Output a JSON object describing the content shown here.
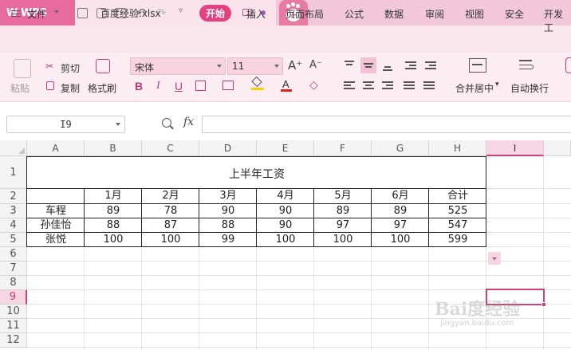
{
  "titlebar": {
    "app_name": "WPS",
    "doc_tab": "百度经验.xlsx"
  },
  "menu": {
    "file": "文件",
    "tabs": [
      "开始",
      "插入",
      "页面布局",
      "公式",
      "数据",
      "审阅",
      "视图",
      "安全",
      "开发工"
    ]
  },
  "ribbon": {
    "paste": "粘贴",
    "cut": "剪切",
    "copy": "复制",
    "format_painter": "格式刷",
    "font_name": "宋体",
    "font_size": "11",
    "merge_center": "合并居中",
    "wrap_text": "自动换行",
    "bold": "B",
    "italic": "I",
    "underline": "U"
  },
  "formula_bar": {
    "name_box": "I9",
    "fx": "fx",
    "formula": ""
  },
  "sheet": {
    "columns": [
      "A",
      "B",
      "C",
      "D",
      "E",
      "F",
      "G",
      "H",
      "I"
    ],
    "rows": [
      "1",
      "2",
      "3",
      "4",
      "5",
      "6",
      "7",
      "8",
      "9",
      "10",
      "11",
      "12"
    ],
    "selected_cell": "I9",
    "title": "上半年工资",
    "header": [
      "",
      "1月",
      "2月",
      "3月",
      "4月",
      "5月",
      "6月",
      "合计"
    ],
    "data": [
      [
        "车程",
        "89",
        "78",
        "90",
        "90",
        "89",
        "89",
        "525"
      ],
      [
        "孙佳怡",
        "88",
        "87",
        "88",
        "90",
        "97",
        "97",
        "547"
      ],
      [
        "张悦",
        "100",
        "100",
        "99",
        "100",
        "100",
        "100",
        "599"
      ]
    ]
  },
  "watermark": {
    "main": "Bai度经验",
    "sub": "jingyan.baidu.com"
  },
  "colors": {
    "accent": "#e5407f",
    "titlebar": "#f1c7d9",
    "ribbon": "#fcedf3"
  }
}
